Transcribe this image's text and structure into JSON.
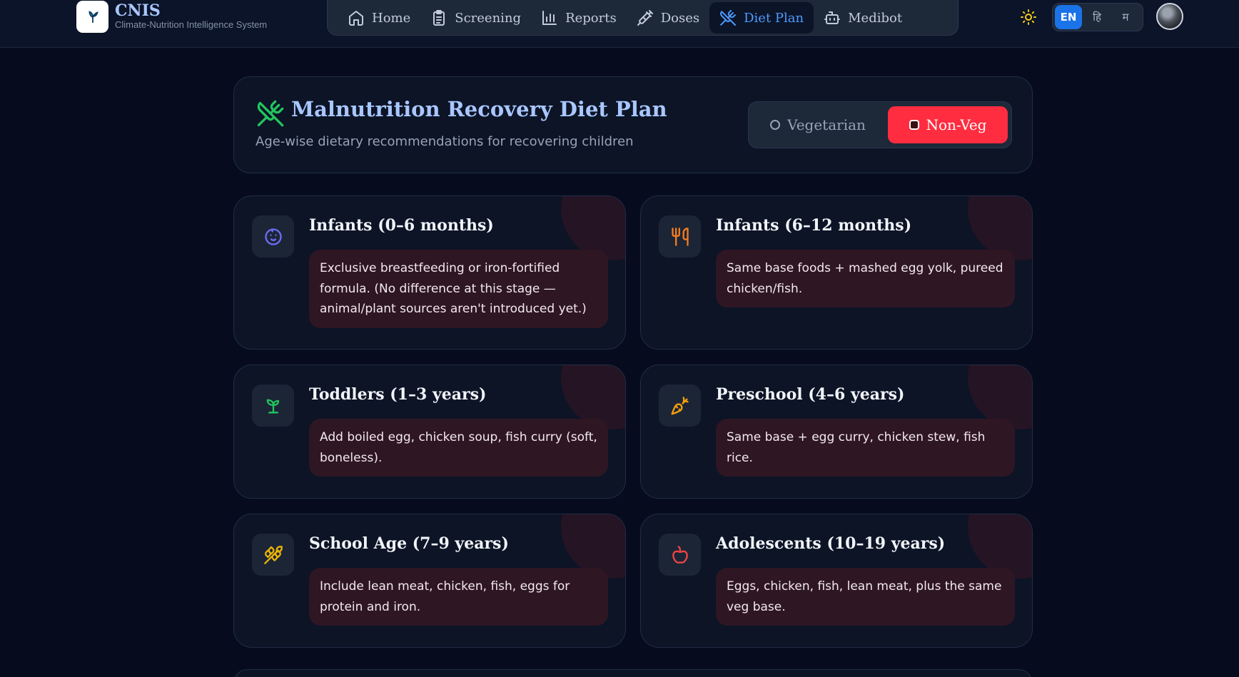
{
  "brand": {
    "name": "CNIS",
    "subtitle": "Climate-Nutrition Intelligence System",
    "logo_icon": "leaf-logo-icon"
  },
  "nav": [
    {
      "label": "Home",
      "icon": "home-icon",
      "active": false
    },
    {
      "label": "Screening",
      "icon": "clipboard-icon",
      "active": false
    },
    {
      "label": "Reports",
      "icon": "bar-chart-icon",
      "active": false
    },
    {
      "label": "Doses",
      "icon": "syringe-icon",
      "active": false
    },
    {
      "label": "Diet Plan",
      "icon": "utensils-crossed-icon",
      "active": true
    },
    {
      "label": "Medibot",
      "icon": "bot-icon",
      "active": false
    }
  ],
  "header": {
    "theme_icon": "sun-icon",
    "languages": [
      {
        "label": "EN",
        "active": true
      },
      {
        "label": "हि",
        "active": false
      },
      {
        "label": "म",
        "active": false
      }
    ]
  },
  "hero": {
    "title": "Malnutrition Recovery Diet Plan",
    "subtitle": "Age-wise dietary recommendations for recovering children",
    "diet_options": [
      {
        "label": "Vegetarian",
        "selected": false
      },
      {
        "label": "Non-Veg",
        "selected": true
      }
    ]
  },
  "cards": [
    {
      "title": "Infants (0–6 months)",
      "body": "Exclusive breastfeeding or iron-fortified formula. (No difference at this stage — animal/plant sources aren't introduced yet.)",
      "icon": "baby-icon",
      "icon_color": "#6d6cf7"
    },
    {
      "title": "Infants (6–12 months)",
      "body": "Same base foods + mashed egg yolk, pureed chicken/fish.",
      "icon": "fork-spoon-icon",
      "icon_color": "#f57c1f"
    },
    {
      "title": "Toddlers (1–3 years)",
      "body": "Add boiled egg, chicken soup, fish curry (soft, boneless).",
      "icon": "sprout-icon",
      "icon_color": "#22c55e"
    },
    {
      "title": "Preschool (4–6 years)",
      "body": "Same base + egg curry, chicken stew, fish rice.",
      "icon": "carrot-icon",
      "icon_color": "#f59e0b"
    },
    {
      "title": "School Age (7–9 years)",
      "body": "Include lean meat, chicken, fish, eggs for protein and iron.",
      "icon": "wheat-icon",
      "icon_color": "#eab308"
    },
    {
      "title": "Adolescents (10–19 years)",
      "body": "Eggs, chicken, fish, lean meat, plus the same veg base.",
      "icon": "apple-icon",
      "icon_color": "#ef4444"
    }
  ],
  "colors": {
    "accent": "#4d9bff",
    "non_veg_active": "#ff2d3f",
    "card_body_bg": "#2f1623"
  }
}
